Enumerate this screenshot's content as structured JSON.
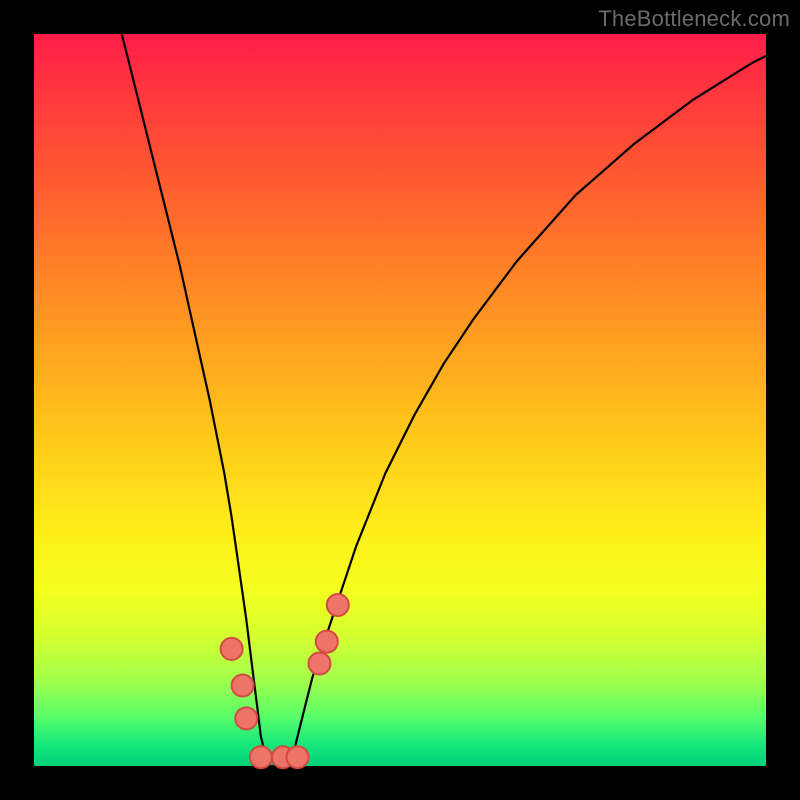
{
  "watermark": "TheBottleneck.com",
  "chart_data": {
    "type": "line",
    "title": "",
    "xlabel": "",
    "ylabel": "",
    "xlim": [
      0,
      100
    ],
    "ylim": [
      0,
      100
    ],
    "grid": false,
    "legend": false,
    "series": [
      {
        "name": "curve",
        "color": "#000000",
        "x": [
          12,
          14,
          16,
          18,
          20,
          22,
          24,
          26,
          27,
          28,
          29,
          30,
          30.5,
          31,
          32,
          33,
          34,
          35,
          36,
          37,
          38,
          40,
          44,
          48,
          52,
          56,
          60,
          66,
          74,
          82,
          90,
          98,
          100
        ],
        "y": [
          100,
          92,
          84,
          76,
          68,
          59,
          50,
          40,
          34,
          27,
          20,
          12,
          8,
          4,
          0,
          0,
          0,
          0,
          4,
          8,
          12,
          18,
          30,
          40,
          48,
          55,
          61,
          69,
          78,
          85,
          91,
          96,
          97
        ]
      }
    ],
    "markers": [
      {
        "x": 27.0,
        "y": 16,
        "r": 11,
        "fill": "#ec7468",
        "stroke": "#d24a40"
      },
      {
        "x": 28.5,
        "y": 11,
        "r": 11,
        "fill": "#ec7468",
        "stroke": "#d24a40"
      },
      {
        "x": 29.0,
        "y": 6.5,
        "r": 11,
        "fill": "#ec7468",
        "stroke": "#d24a40"
      },
      {
        "x": 31.0,
        "y": 1.2,
        "r": 11,
        "fill": "#ec7468",
        "stroke": "#d24a40"
      },
      {
        "x": 34.0,
        "y": 1.2,
        "r": 11,
        "fill": "#ec7468",
        "stroke": "#d24a40"
      },
      {
        "x": 36.0,
        "y": 1.2,
        "r": 11,
        "fill": "#ec7468",
        "stroke": "#d24a40"
      },
      {
        "x": 39.0,
        "y": 14,
        "r": 11,
        "fill": "#ec7468",
        "stroke": "#d24a40"
      },
      {
        "x": 40.0,
        "y": 17,
        "r": 11,
        "fill": "#ec7468",
        "stroke": "#d24a40"
      },
      {
        "x": 41.5,
        "y": 22,
        "r": 11,
        "fill": "#ec7468",
        "stroke": "#d24a40"
      }
    ],
    "gradient_stops": [
      {
        "pos": 0,
        "color": "#ff1d4a"
      },
      {
        "pos": 18,
        "color": "#ff5532"
      },
      {
        "pos": 42,
        "color": "#ffa020"
      },
      {
        "pos": 68,
        "color": "#ffee1a"
      },
      {
        "pos": 88,
        "color": "#a6ff4a"
      },
      {
        "pos": 100,
        "color": "#00d27a"
      }
    ]
  }
}
